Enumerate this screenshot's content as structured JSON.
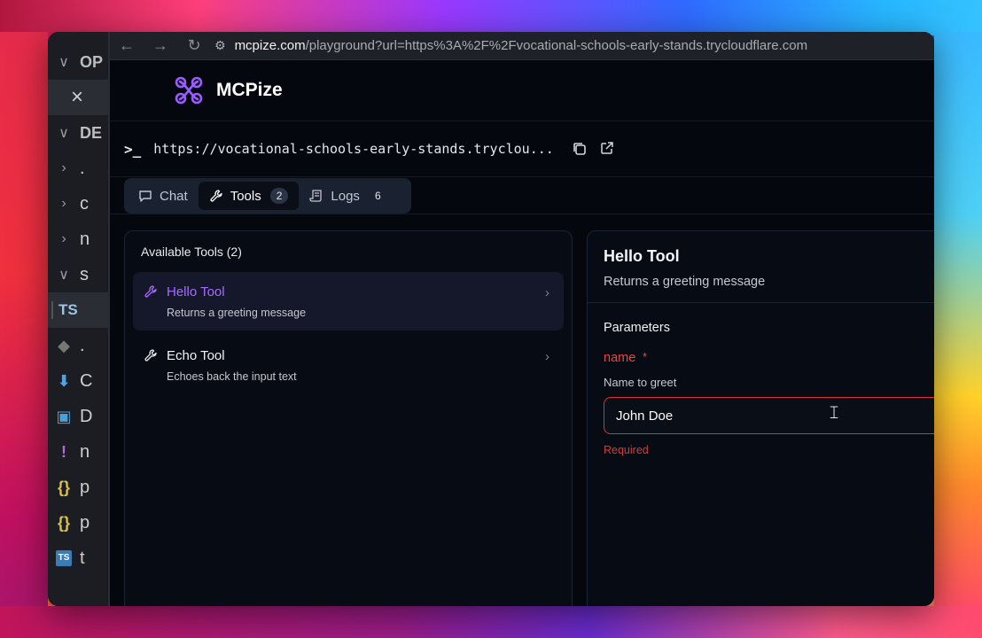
{
  "vscode": {
    "rows": [
      {
        "chevron": "∨",
        "text": "OP",
        "selected": false
      },
      {
        "chevron": "",
        "text": "×",
        "selected": true
      },
      {
        "chevron": "∨",
        "text": "DE",
        "selected": false
      },
      {
        "chevron": "›",
        "text": ".",
        "selected": false
      },
      {
        "chevron": "›",
        "text": "c",
        "selected": false
      },
      {
        "chevron": "›",
        "text": "n",
        "selected": false
      },
      {
        "chevron": "∨",
        "text": "s",
        "selected": false
      },
      {
        "chevron": "",
        "text": "TS",
        "selected": true
      },
      {
        "chevron": "",
        "text": ".",
        "selected": false
      },
      {
        "chevron": "",
        "text": "C",
        "selected": false
      },
      {
        "chevron": "",
        "text": "D",
        "selected": false
      },
      {
        "chevron": "",
        "text": "n",
        "selected": false
      },
      {
        "chevron": "",
        "text": "p",
        "selected": false
      },
      {
        "chevron": "",
        "text": "p",
        "selected": false
      },
      {
        "chevron": "",
        "text": "t",
        "selected": false
      }
    ]
  },
  "browser": {
    "url_host": "mcpize.com",
    "url_rest": "/playground?url=https%3A%2F%2Fvocational-schools-early-stands.trycloudflare.com"
  },
  "app": {
    "brand": "MCPize",
    "server_url": "https://vocational-schools-early-stands.tryclou...",
    "prompt": ">_"
  },
  "tabs": [
    {
      "label": "Chat",
      "icon": "chat-icon",
      "badge": null,
      "active": false
    },
    {
      "label": "Tools",
      "icon": "wrench-icon",
      "badge": "2",
      "active": true
    },
    {
      "label": "Logs",
      "icon": "logs-icon",
      "badge": "6",
      "active": false
    }
  ],
  "tools_panel": {
    "title": "Available Tools (2)",
    "items": [
      {
        "name": "Hello Tool",
        "description": "Returns a greeting message",
        "active": true
      },
      {
        "name": "Echo Tool",
        "description": "Echoes back the input text",
        "active": false
      }
    ]
  },
  "detail": {
    "title": "Hello Tool",
    "description": "Returns a greeting message",
    "parameters_title": "Parameters",
    "param_name": "name",
    "param_required_mark": "*",
    "param_help": "Name to greet",
    "param_value": "John Doe",
    "param_error": "Required"
  },
  "colors": {
    "accent_purple": "#a66cff",
    "error_red": "#ef4444",
    "background": "#04070e"
  }
}
